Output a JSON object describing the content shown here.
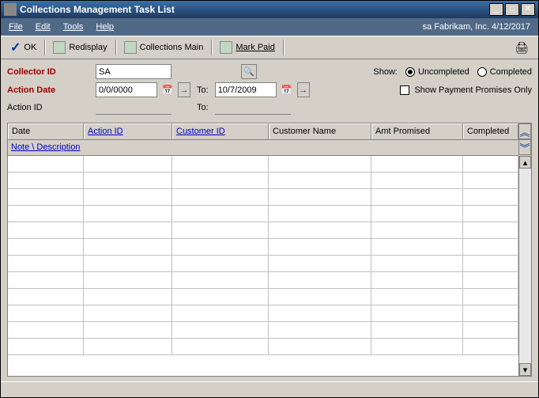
{
  "titlebar": {
    "title": "Collections Management Task List"
  },
  "menubar": {
    "file": "File",
    "edit": "Edit",
    "tools": "Tools",
    "help": "Help",
    "right": "sa Fabrikam, Inc. 4/12/2017"
  },
  "toolbar": {
    "ok": "OK",
    "redisplay": "Redisplay",
    "collections_main": "Collections Main",
    "mark_paid": "Mark Paid"
  },
  "filters": {
    "collector_label": "Collector ID",
    "collector_value": "SA",
    "action_date_label": "Action Date",
    "from_date": "0/0/0000",
    "to_label": "To:",
    "to_date": "10/7/2009",
    "action_id_label": "Action ID",
    "action_id_from": "",
    "action_id_to_label": "To:",
    "action_id_to": "",
    "show_label": "Show:",
    "uncompleted_label": "Uncompleted",
    "completed_label": "Completed",
    "promises_label": "Show Payment Promises Only"
  },
  "grid": {
    "headers": {
      "date": "Date",
      "action_id": "Action ID",
      "customer_id": "Customer ID",
      "customer_name": "Customer Name",
      "amt_promised": "Amt Promised",
      "completed": "Completed"
    },
    "subheader": "Note \\ Description",
    "rows": [
      {},
      {},
      {},
      {},
      {},
      {},
      {},
      {},
      {},
      {},
      {},
      {}
    ]
  }
}
